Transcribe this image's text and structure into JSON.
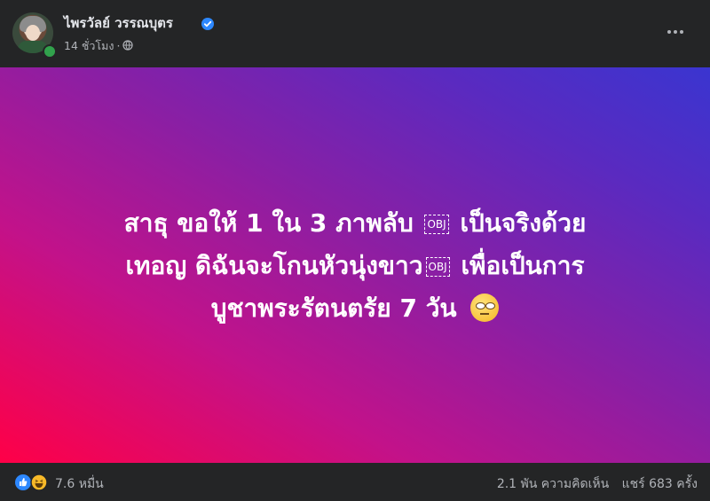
{
  "author": {
    "name": "ไพรวัลย์ วรรณบุตร",
    "time": "14 ชั่วโมง",
    "separator": "·"
  },
  "post": {
    "line1": "สาธุ ขอให้ 1 ใน 3 ภาพลับ",
    "line1b": "เป็นจริงด้วย",
    "line2": "เทอญ ดิฉันจะโกนหัวนุ่งขาว",
    "line2b": "เพื่อเป็นการ",
    "line3": "บูชาพระรัตนตรัย 7 วัน",
    "obj_glyph": "OBJ",
    "emoji": "face-with-rolling-eyes"
  },
  "footer": {
    "reactions": "7.6 หมื่น",
    "comments": "2.1 พัน ความคิดเห็น",
    "shares": "แชร์ 683 ครั้ง"
  },
  "colors": {
    "background": "#242526",
    "gradient_start": "#ff0047",
    "gradient_end": "#3a35d0",
    "verified": "#2d88ff",
    "online": "#31a24c"
  }
}
